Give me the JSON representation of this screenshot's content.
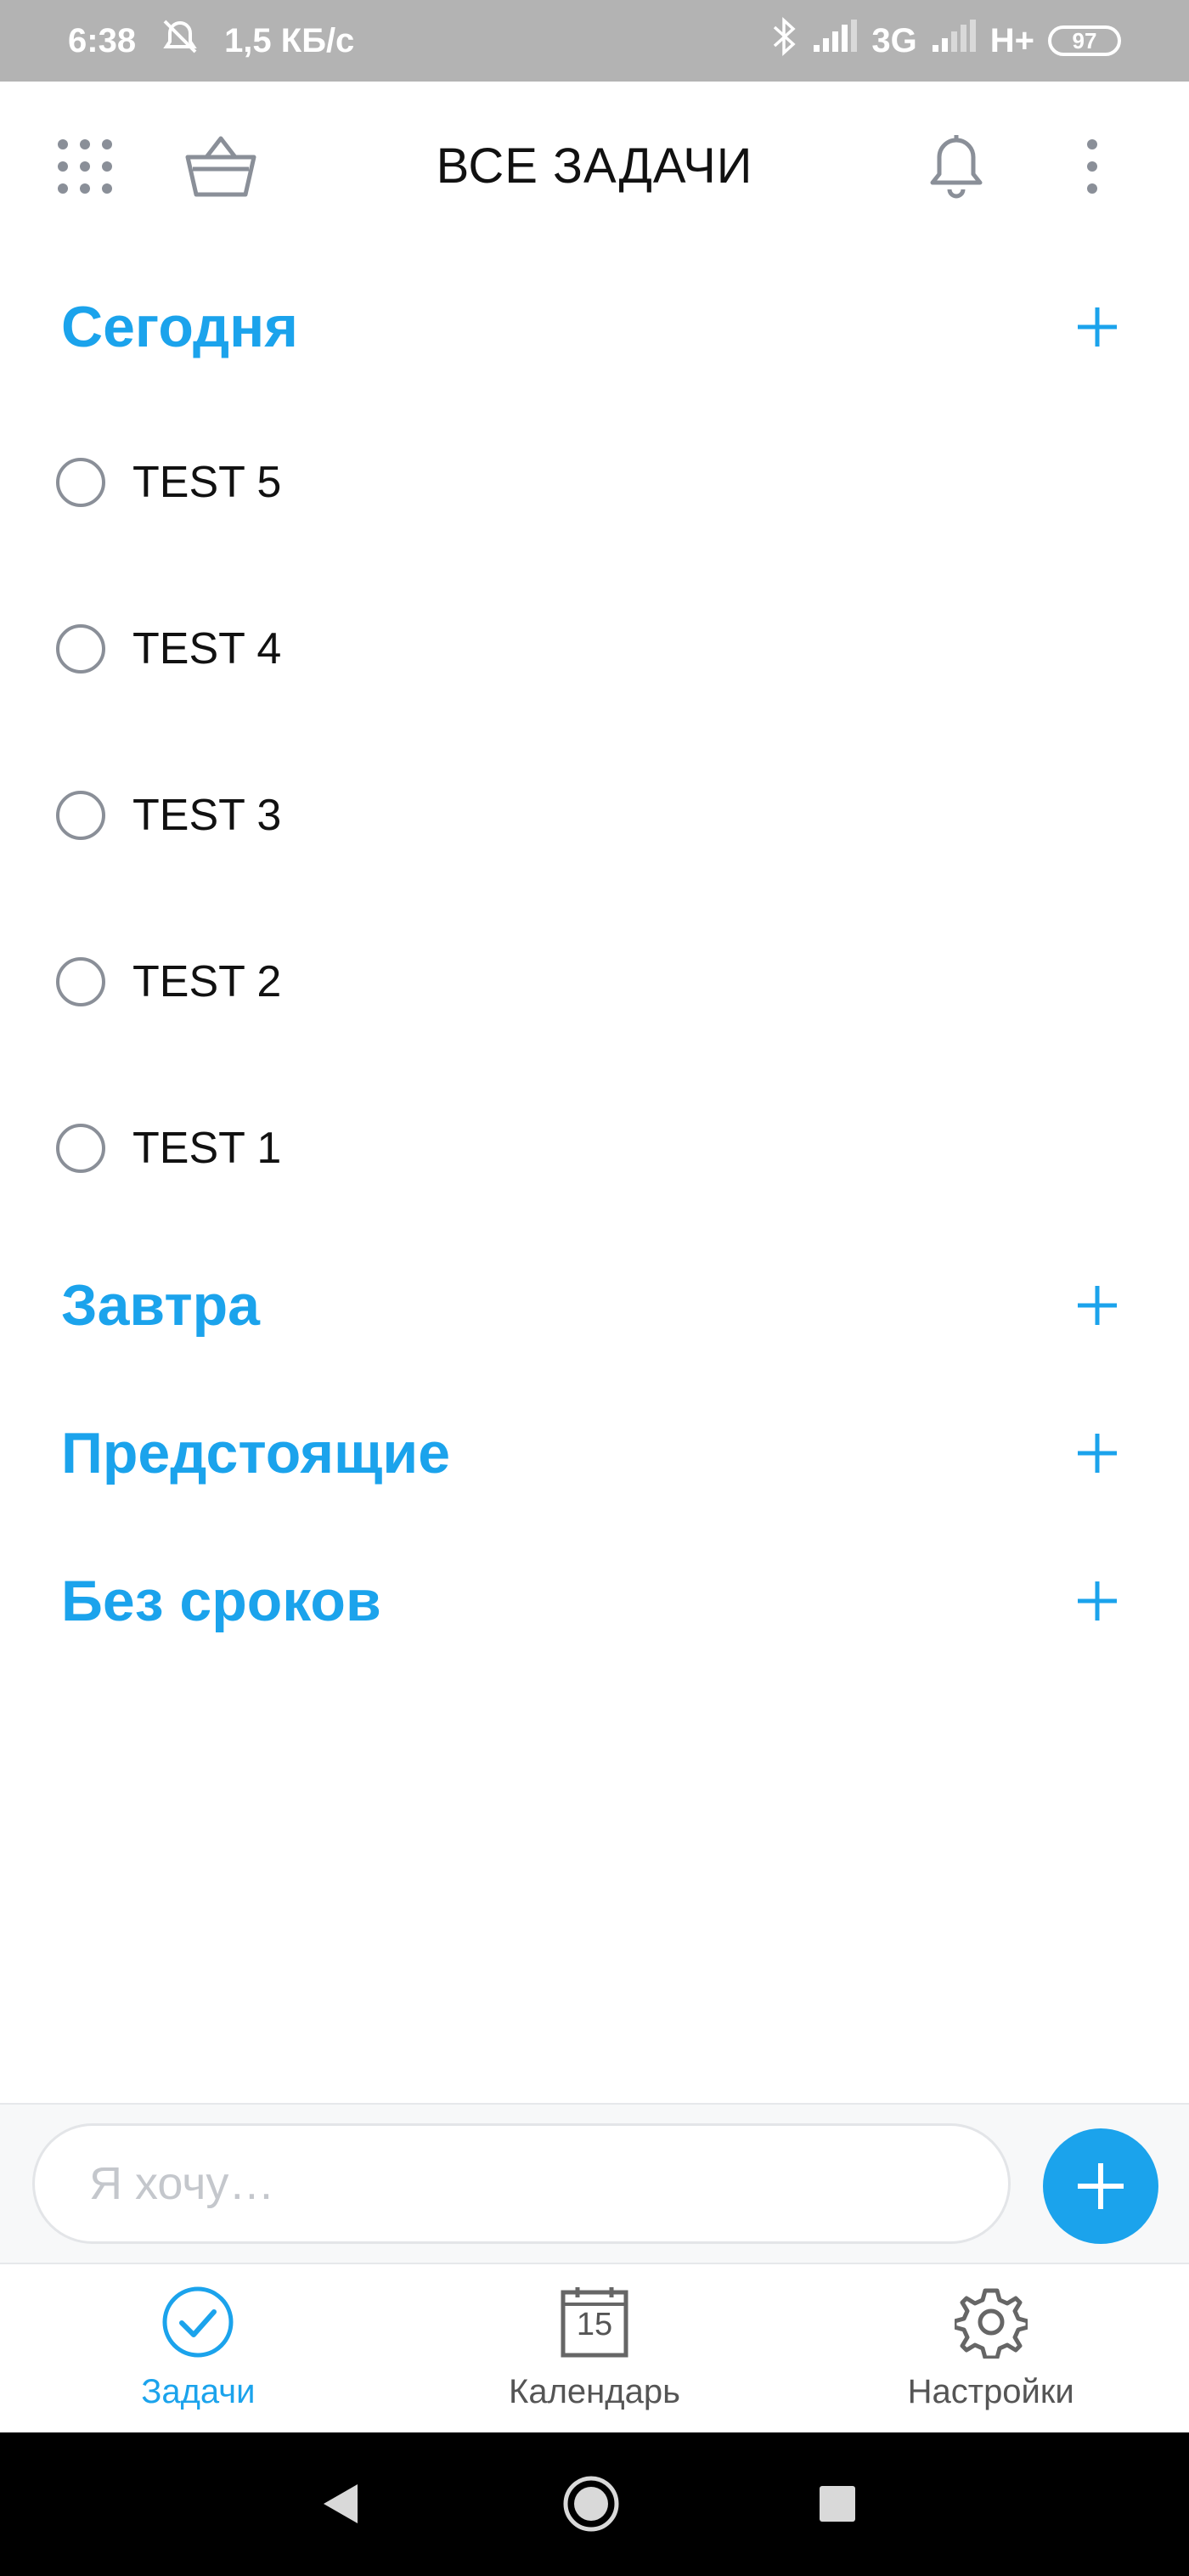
{
  "status_bar": {
    "time": "6:38",
    "speed": "1,5 КБ/с",
    "network1": "3G",
    "network2": "H+",
    "battery": "97"
  },
  "header": {
    "title": "ВСЕ ЗАДАЧИ"
  },
  "sections": {
    "today": {
      "title": "Сегодня",
      "tasks": [
        "TEST 5",
        "TEST 4",
        "TEST 3",
        "TEST 2",
        "TEST 1"
      ]
    },
    "tomorrow": {
      "title": "Завтра"
    },
    "upcoming": {
      "title": "Предстоящие"
    },
    "no_deadline": {
      "title": "Без сроков"
    }
  },
  "input": {
    "placeholder": "Я хочу…"
  },
  "tabs": [
    {
      "label": "Задачи",
      "icon": "check-circle-icon",
      "active": true
    },
    {
      "label": "Календарь",
      "icon": "calendar-icon",
      "day": "15",
      "active": false
    },
    {
      "label": "Настройки",
      "icon": "gear-icon",
      "active": false
    }
  ],
  "colors": {
    "accent": "#1ba3ec",
    "status_bar": "#b3b3b3",
    "nav_bar": "#000000"
  }
}
